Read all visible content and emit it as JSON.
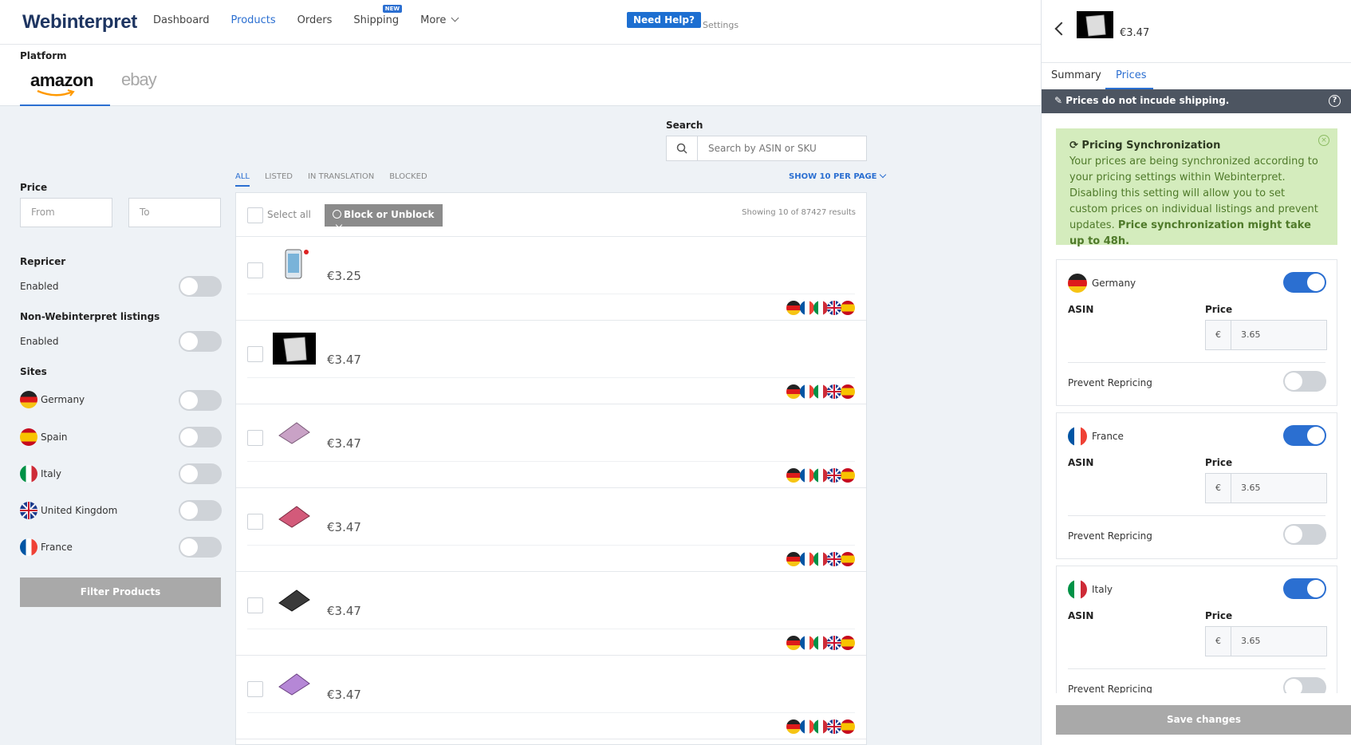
{
  "brand": {
    "logo": "Webinterpret"
  },
  "nav": {
    "items": [
      {
        "label": "Dashboard"
      },
      {
        "label": "Products"
      },
      {
        "label": "Orders"
      },
      {
        "label": "Shipping",
        "badge": "NEW"
      },
      {
        "label": "More"
      }
    ],
    "help": "Need Help?",
    "settings": "Settings"
  },
  "platform": {
    "title": "Platform",
    "amazon": "amazon",
    "ebay": "ebay"
  },
  "filters": {
    "price_title": "Price",
    "from_placeholder": "From",
    "to_placeholder": "To",
    "repricer_title": "Repricer",
    "repricer_enabled": "Enabled",
    "nonwi_title": "Non-Webinterpret listings",
    "nonwi_enabled": "Enabled",
    "sites_title": "Sites",
    "sites": [
      {
        "label": "Germany"
      },
      {
        "label": "Spain"
      },
      {
        "label": "Italy"
      },
      {
        "label": "United Kingdom"
      },
      {
        "label": "France"
      }
    ],
    "button": "Filter Products"
  },
  "search": {
    "title": "Search",
    "placeholder": "Search by ASIN or SKU"
  },
  "tabs": [
    {
      "label": "ALL"
    },
    {
      "label": "LISTED"
    },
    {
      "label": "IN TRANSLATION"
    },
    {
      "label": "BLOCKED"
    }
  ],
  "perpage": "SHOW 10 PER PAGE",
  "list": {
    "select_all": "Select all",
    "block_button": "Block or Unblock",
    "showing": "Showing 10 of 87427 results",
    "rows": [
      {
        "price": "€3.25"
      },
      {
        "price": "€3.47"
      },
      {
        "price": "€3.47"
      },
      {
        "price": "€3.47"
      },
      {
        "price": "€3.47"
      },
      {
        "price": "€3.47"
      }
    ]
  },
  "panel": {
    "price": "€3.47",
    "tabs": [
      {
        "label": "Summary"
      },
      {
        "label": "Prices"
      }
    ],
    "notice": "Prices do not incude shipping.",
    "help_icon": "?",
    "sync": {
      "title": "Pricing Synchronization",
      "body": "Your prices are being synchronized according to your pricing settings within Webinterpret. Disabling this setting will allow you to set custom prices on individual listings and prevent updates.",
      "bold": "Price synchronization might take up to 48h."
    },
    "countries": [
      {
        "name": "Germany",
        "asin_label": "ASIN",
        "price_label": "Price",
        "currency": "€",
        "value": "3.65",
        "prevent": "Prevent Repricing"
      },
      {
        "name": "France",
        "asin_label": "ASIN",
        "price_label": "Price",
        "currency": "€",
        "value": "3.65",
        "prevent": "Prevent Repricing"
      },
      {
        "name": "Italy",
        "asin_label": "ASIN",
        "price_label": "Price",
        "currency": "€",
        "value": "3.65",
        "prevent": "Prevent Repricing"
      }
    ],
    "save": "Save changes"
  }
}
